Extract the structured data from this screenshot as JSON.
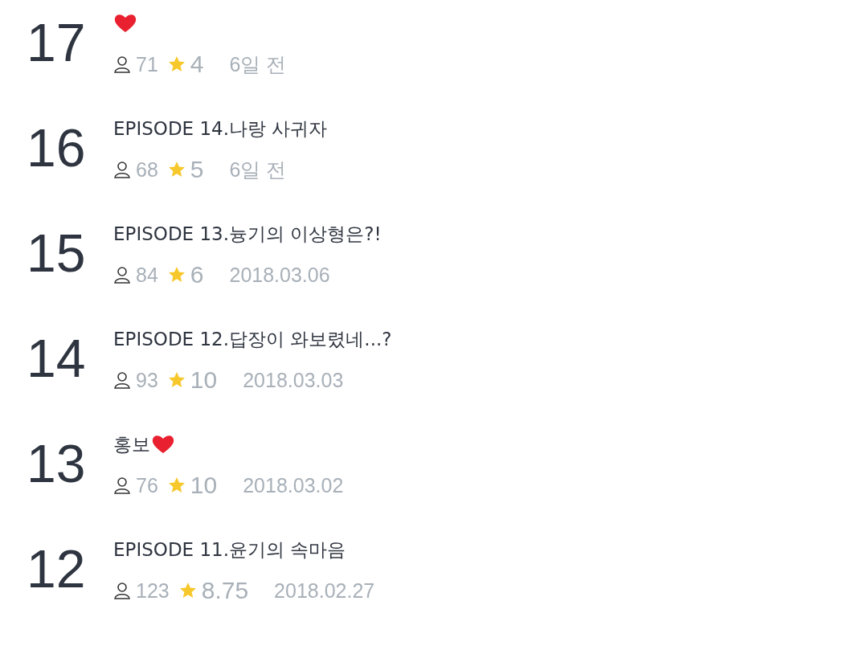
{
  "episodes": [
    {
      "number": "17",
      "heart": true,
      "views": "71",
      "rating": "4",
      "date": "6일 전"
    },
    {
      "number": "16",
      "title": "EPISODE 14.나랑 사귀자",
      "heart": false,
      "views": "68",
      "rating": "5",
      "date": "6일 전"
    },
    {
      "number": "15",
      "title": "EPISODE 13.늉기의 이상형은?!",
      "heart": false,
      "views": "84",
      "rating": "6",
      "date": "2018.03.06"
    },
    {
      "number": "14",
      "title": "EPISODE 12.답장이 와보렸네...?",
      "heart": false,
      "views": "93",
      "rating": "10",
      "date": "2018.03.03"
    },
    {
      "number": "13",
      "title": "홍보",
      "heart": true,
      "views": "76",
      "rating": "10",
      "date": "2018.03.02"
    },
    {
      "number": "12",
      "title": "EPISODE 11.윤기의 속마음",
      "heart": false,
      "views": "123",
      "rating": "8.75",
      "date": "2018.02.27"
    }
  ]
}
